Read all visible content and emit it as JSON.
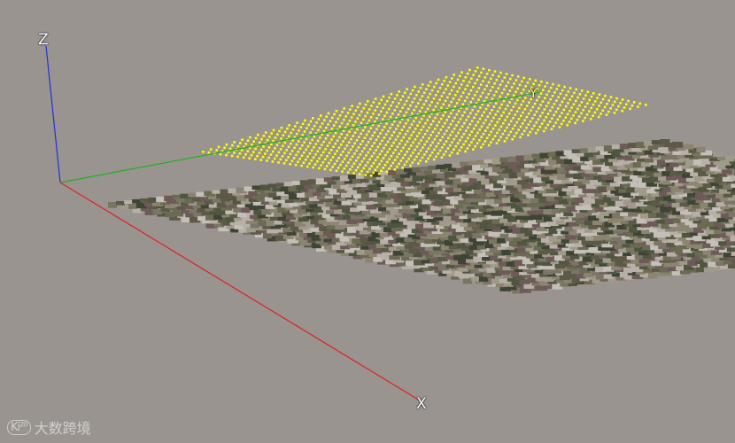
{
  "axes": {
    "x_label": "X",
    "y_label": "Y",
    "z_label": "Z",
    "colors": {
      "x": "#e02020",
      "y": "#20b020",
      "z": "#2030e0"
    }
  },
  "scene": {
    "background": "#99948f",
    "point_grid_color": "#ffff00",
    "terrain_colors": [
      "#5c5a47",
      "#6b6a52",
      "#7a7564",
      "#4f5640",
      "#8a8470",
      "#a09a8a",
      "#6e5a58",
      "#b8b0a8",
      "#3f4535",
      "#c4bfb8"
    ]
  },
  "watermark": {
    "logo": "Ki²⁰",
    "text": "大数跨境"
  }
}
